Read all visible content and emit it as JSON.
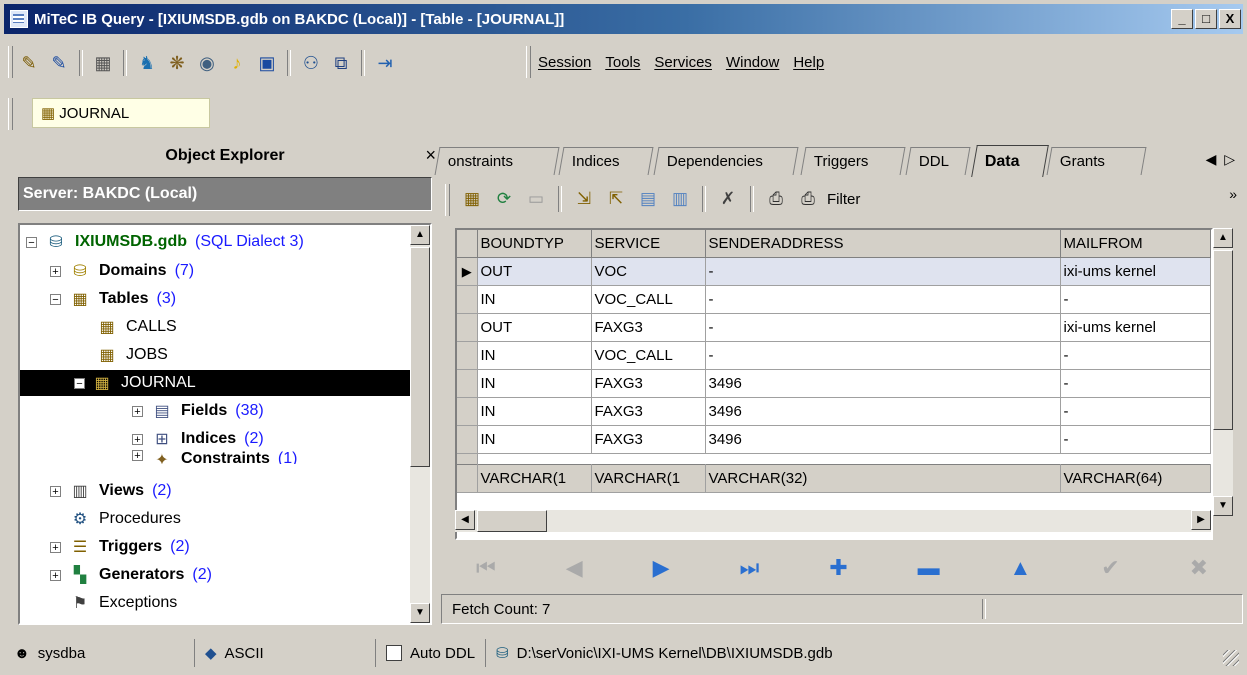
{
  "window": {
    "title": "MiTeC IB Query - [IXIUMSDB.gdb on BAKDC (Local)] - [Table - [JOURNAL]]",
    "min": "_",
    "max": "□",
    "close": "X"
  },
  "menu": [
    "Session",
    "Tools",
    "Services",
    "Window",
    "Help"
  ],
  "doc_tab": {
    "label": "JOURNAL"
  },
  "explorer": {
    "title": "Object Explorer",
    "close": "×",
    "server": "Server: BAKDC (Local)",
    "db": {
      "name": "IXIUMSDB.gdb",
      "dialect": "(SQL Dialect 3)"
    },
    "domains": {
      "label": "Domains",
      "count": "(7)"
    },
    "tables": {
      "label": "Tables",
      "count": "(3)"
    },
    "calls": "CALLS",
    "jobs": "JOBS",
    "journal": "JOURNAL",
    "fields": {
      "label": "Fields",
      "count": "(38)"
    },
    "indices": {
      "label": "Indices",
      "count": "(2)"
    },
    "constraints": {
      "label": "Constraints",
      "count": "(1)"
    },
    "views": {
      "label": "Views",
      "count": "(2)"
    },
    "procedures": "Procedures",
    "triggers": {
      "label": "Triggers",
      "count": "(2)"
    },
    "generators": {
      "label": "Generators",
      "count": "(2)"
    },
    "exceptions": "Exceptions"
  },
  "tabs": [
    "onstraints",
    "Indices",
    "Dependencies",
    "Triggers",
    "DDL",
    "Data",
    "Grants"
  ],
  "data_toolbar": {
    "filter": "Filter",
    "more": "»"
  },
  "grid": {
    "columns": [
      "BOUNDTYP",
      "SERVICE",
      "SENDERADDRESS",
      "MAILFROM"
    ],
    "rows": [
      [
        "OUT",
        "VOC",
        "-",
        "ixi-ums kernel"
      ],
      [
        "IN",
        "VOC_CALL",
        "-",
        "-"
      ],
      [
        "OUT",
        "FAXG3",
        "-",
        "ixi-ums kernel"
      ],
      [
        "IN",
        "VOC_CALL",
        "-",
        "-"
      ],
      [
        "IN",
        "FAXG3",
        "3496",
        "-"
      ],
      [
        "IN",
        "FAXG3",
        "3496",
        "-"
      ],
      [
        "IN",
        "FAXG3",
        "3496",
        "-"
      ]
    ],
    "types": [
      "VARCHAR(1",
      "VARCHAR(1",
      "VARCHAR(32)",
      "VARCHAR(64)"
    ]
  },
  "fetch": "Fetch Count: 7",
  "status": {
    "user": "sysdba",
    "charset": "ASCII",
    "autoddl": "Auto DDL",
    "path": "D:\\serVonic\\IXI-UMS Kernel\\DB\\IXIUMSDB.gdb"
  }
}
